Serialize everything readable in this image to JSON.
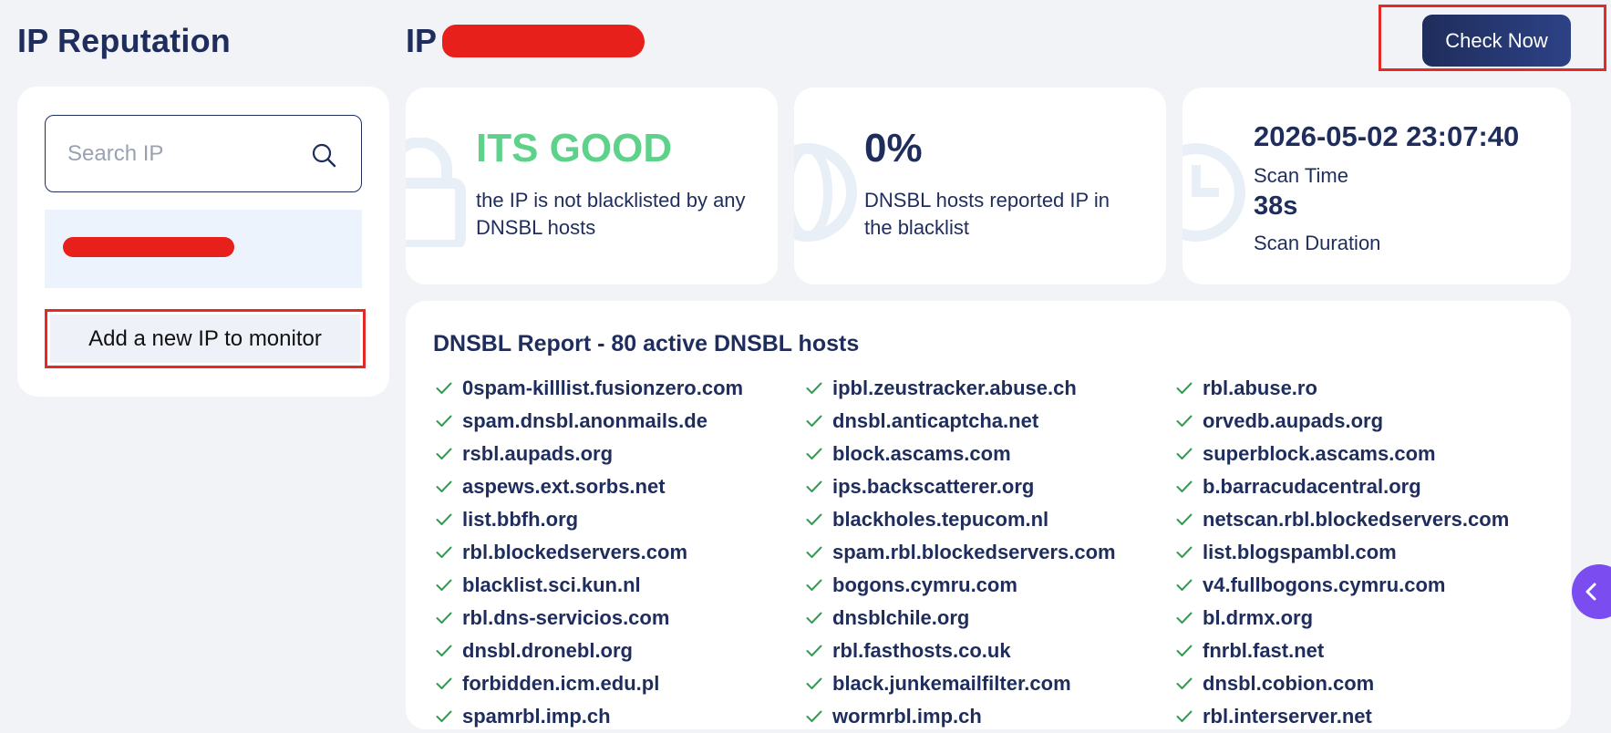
{
  "header": {
    "page_title": "IP Reputation",
    "ip_label": "IP",
    "check_now": "Check Now"
  },
  "sidebar": {
    "search_placeholder": "Search IP",
    "add_ip": "Add a new IP to monitor"
  },
  "stats": {
    "status_value": "ITS GOOD",
    "status_desc": "the IP is not blacklisted by any DNSBL hosts",
    "percent_value": "0%",
    "percent_desc": "DNSBL hosts reported IP in the blacklist",
    "scan_time_value": "2026-05-02 23:07:40",
    "scan_time_label": "Scan Time",
    "scan_duration_value": "38s",
    "scan_duration_label": "Scan Duration"
  },
  "report": {
    "title": "DNSBL Report - 80 active DNSBL hosts",
    "columns": [
      [
        "0spam-killlist.fusionzero.com",
        "spam.dnsbl.anonmails.de",
        "rsbl.aupads.org",
        "aspews.ext.sorbs.net",
        "list.bbfh.org",
        "rbl.blockedservers.com",
        "blacklist.sci.kun.nl",
        "rbl.dns-servicios.com",
        "dnsbl.dronebl.org",
        "forbidden.icm.edu.pl",
        "spamrbl.imp.ch"
      ],
      [
        "ipbl.zeustracker.abuse.ch",
        "dnsbl.anticaptcha.net",
        "block.ascams.com",
        "ips.backscatterer.org",
        "blackholes.tepucom.nl",
        "spam.rbl.blockedservers.com",
        "bogons.cymru.com",
        "dnsblchile.org",
        "rbl.fasthosts.co.uk",
        "black.junkemailfilter.com",
        "wormrbl.imp.ch"
      ],
      [
        "rbl.abuse.ro",
        "orvedb.aupads.org",
        "superblock.ascams.com",
        "b.barracudacentral.org",
        "netscan.rbl.blockedservers.com",
        "list.blogspambl.com",
        "v4.fullbogons.cymru.com",
        "bl.drmx.org",
        "fnrbl.fast.net",
        "dnsbl.cobion.com",
        "rbl.interserver.net"
      ]
    ]
  },
  "colors": {
    "navy": "#1f2d5c",
    "good_green": "#5ed28a",
    "check_green": "#2e9e4f",
    "highlight_red": "#e32a27",
    "float_purple": "#7b4cf0"
  },
  "icons": [
    "search-icon",
    "lock-icon",
    "globe-icon",
    "clock-icon",
    "check-icon",
    "chevron-left-icon"
  ]
}
